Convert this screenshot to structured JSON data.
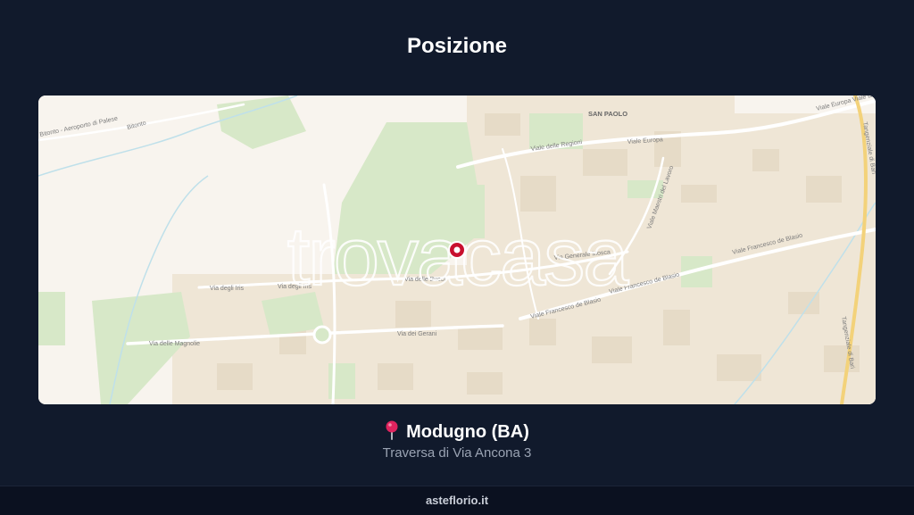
{
  "header": {
    "title": "Posizione"
  },
  "map": {
    "watermark": "trovacasa",
    "marker_icon": "map-marker-icon",
    "labels": {
      "district": "SAN PAOLO",
      "road_aeroporto": "Bitonto - Aeroporto di Palese",
      "road_bitonto": "Bitonto",
      "via_regioni": "Viale delle Regioni",
      "viale_europa": "Viale Europa",
      "viale_europa_2": "Viale Europa  Viale Euro",
      "via_maestri": "Viale Maestri del Lavoro",
      "via_francesco_blasio_1": "Viale Francesco de Blasio",
      "via_francesco_blasio_2": "Viale Francesco de Blasio",
      "via_francesco_blasio_3": "Viale Francesco de Blasio",
      "via_iris_1": "Via degli Iris",
      "via_iris_2": "Via degli Iris",
      "via_bucci": "Via delle Bucci",
      "via_magnolie": "Via delle Magnolie",
      "via_gerani": "Via dei Gerani",
      "via_generale": "Via Generale Mosca",
      "tangenziale_1": "Tangenziale di Bari",
      "tangenziale_2": "Tangenziale di Bari"
    },
    "colors": {
      "marker": "#c8102e",
      "park": "#cfe3c0",
      "road": "#ffffff",
      "highway": "#f3d27a",
      "water": "#bfe0ea"
    }
  },
  "location": {
    "pin_icon": "round-pushpin-icon",
    "city": "Modugno (BA)",
    "address": "Traversa di Via Ancona 3"
  },
  "footer": {
    "site": "asteflorio.it"
  }
}
